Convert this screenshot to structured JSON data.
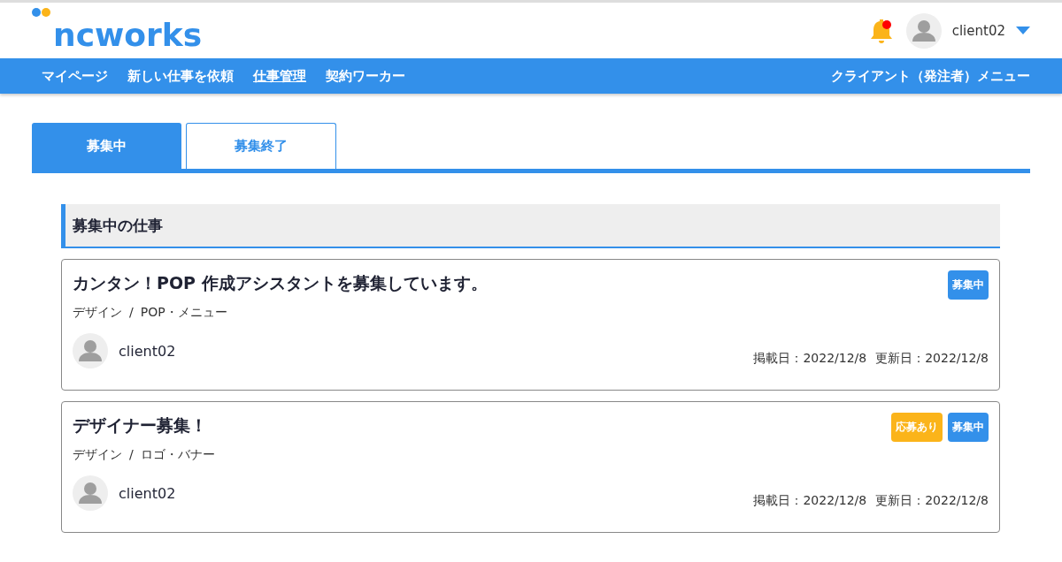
{
  "header": {
    "logo": "ncworks",
    "notification": {
      "unread": true
    },
    "user": {
      "name": "client02"
    }
  },
  "nav": {
    "items": [
      {
        "label": "マイページ",
        "selected": false
      },
      {
        "label": "新しい仕事を依頼",
        "selected": false
      },
      {
        "label": "仕事管理",
        "selected": true
      },
      {
        "label": "契約ワーカー",
        "selected": false
      }
    ],
    "menu": "クライアント（発注者）メニュー"
  },
  "tabs": [
    {
      "label": "募集中",
      "selected": true
    },
    {
      "label": "募集終了",
      "selected": false
    }
  ],
  "section": {
    "title": "募集中の仕事"
  },
  "jobs": [
    {
      "title": "カンタン！POP 作成アシスタントを募集しています。",
      "category": "デザイン",
      "separator": "/",
      "subcategory": "POP・メニュー",
      "client": "client02",
      "posted": "掲載日：2022/12/8",
      "updated": "更新日：2022/12/8",
      "badges": [
        {
          "kind": "open",
          "label": "募集中"
        }
      ]
    },
    {
      "title": "デザイナー募集！",
      "category": "デザイン",
      "separator": "/",
      "subcategory": "ロゴ・バナー",
      "client": "client02",
      "posted": "掲載日：2022/12/8",
      "updated": "更新日：2022/12/8",
      "badges": [
        {
          "kind": "applied",
          "label": "応募あり"
        },
        {
          "kind": "open",
          "label": "募集中"
        }
      ]
    }
  ]
}
